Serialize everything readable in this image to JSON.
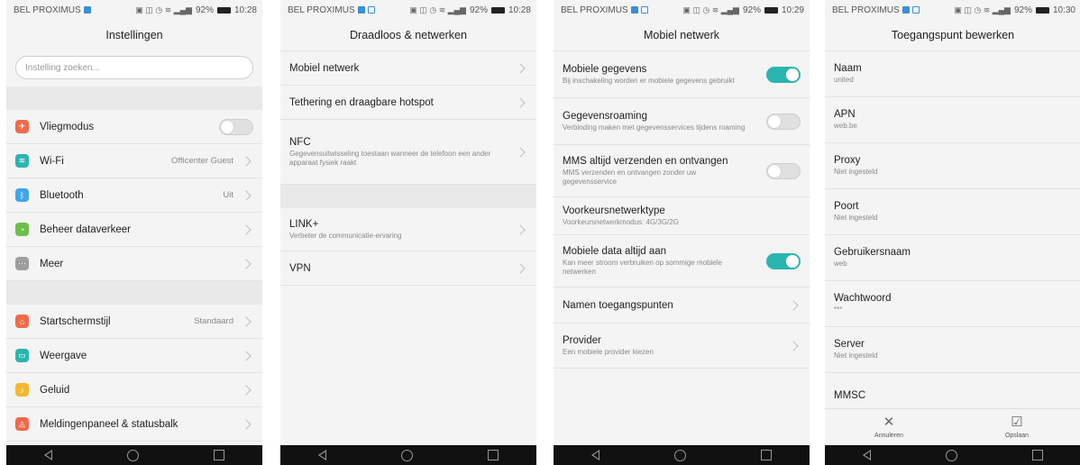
{
  "status": [
    {
      "carrier": "BEL PROXIMUS",
      "battery": "92%",
      "time": "10:28"
    },
    {
      "carrier": "BEL PROXIMUS",
      "battery": "92%",
      "time": "10:28"
    },
    {
      "carrier": "BEL PROXIMUS",
      "battery": "92%",
      "time": "10:29"
    },
    {
      "carrier": "BEL PROXIMUS",
      "battery": "92%",
      "time": "10:30"
    }
  ],
  "settings": {
    "title": "Instellingen",
    "search_placeholder": "Instelling zoeken...",
    "group1": [
      {
        "label": "Vliegmodus",
        "icon": "airplane-icon",
        "color": "#f06a4c",
        "control": "toggle",
        "on": false
      },
      {
        "label": "Wi-Fi",
        "icon": "wifi-icon",
        "color": "#2bb5b0",
        "value": "Officenter Guest"
      },
      {
        "label": "Bluetooth",
        "icon": "bluetooth-icon",
        "color": "#3fa7e6",
        "value": "Uit"
      },
      {
        "label": "Beheer dataverkeer",
        "icon": "data-usage-icon",
        "color": "#6cc04a",
        "value": ""
      },
      {
        "label": "Meer",
        "icon": "more-icon",
        "color": "#9e9e9e",
        "value": ""
      }
    ],
    "group2": [
      {
        "label": "Startschermstijl",
        "icon": "home-style-icon",
        "color": "#f06a4c",
        "value": "Standaard"
      },
      {
        "label": "Weergave",
        "icon": "display-icon",
        "color": "#2bb5b0",
        "value": ""
      },
      {
        "label": "Geluid",
        "icon": "sound-icon",
        "color": "#f5b731",
        "value": ""
      },
      {
        "label": "Meldingenpaneel & statusbalk",
        "icon": "notification-icon",
        "color": "#f06a4c",
        "value": ""
      }
    ]
  },
  "wireless": {
    "title": "Draadloos & netwerken",
    "group1": [
      {
        "label": "Mobiel netwerk",
        "sub": ""
      },
      {
        "label": "Tethering en draagbare hotspot",
        "sub": ""
      },
      {
        "label": "NFC",
        "sub": "Gegevensuitwisseling toestaan wanneer de telefoon een ander apparaat fysiek raakt"
      }
    ],
    "group2": [
      {
        "label": "LINK+",
        "sub": "Verbeter de communicatie-ervaring"
      },
      {
        "label": "VPN",
        "sub": ""
      }
    ]
  },
  "mobile": {
    "title": "Mobiel netwerk",
    "items": [
      {
        "label": "Mobiele gegevens",
        "sub": "Bij inschakeling worden er mobiele gegevens gebruikt",
        "control": "toggle",
        "on": true
      },
      {
        "label": "Gegevensroaming",
        "sub": "Verbinding maken met gegevensservices tijdens roaming",
        "control": "toggle",
        "on": false
      },
      {
        "label": "MMS altijd verzenden en ontvangen",
        "sub": "MMS verzenden en ontvangen zonder uw gegevensservice",
        "control": "toggle",
        "on": false
      },
      {
        "label": "Voorkeursnetwerktype",
        "sub": "Voorkeursnetwerkmodus: 4G/3G/2G",
        "control": "none"
      },
      {
        "label": "Mobiele data altijd aan",
        "sub": "Kan meer stroom verbruiken op sommige mobiele netwerken",
        "control": "toggle",
        "on": true
      },
      {
        "label": "Namen toegangspunten",
        "sub": "",
        "control": "chevron"
      },
      {
        "label": "Provider",
        "sub": "Een mobiele provider kiezen",
        "control": "chevron"
      }
    ]
  },
  "apn": {
    "title": "Toegangspunt bewerken",
    "fields": [
      {
        "label": "Naam",
        "value": "united"
      },
      {
        "label": "APN",
        "value": "web.be"
      },
      {
        "label": "Proxy",
        "value": "Niet ingesteld"
      },
      {
        "label": "Poort",
        "value": "Niet ingesteld"
      },
      {
        "label": "Gebruikersnaam",
        "value": "web"
      },
      {
        "label": "Wachtwoord",
        "value": "***"
      },
      {
        "label": "Server",
        "value": "Niet ingesteld"
      },
      {
        "label": "MMSC",
        "value": ""
      }
    ],
    "cancel_label": "Annuleren",
    "save_label": "Opslaan"
  }
}
